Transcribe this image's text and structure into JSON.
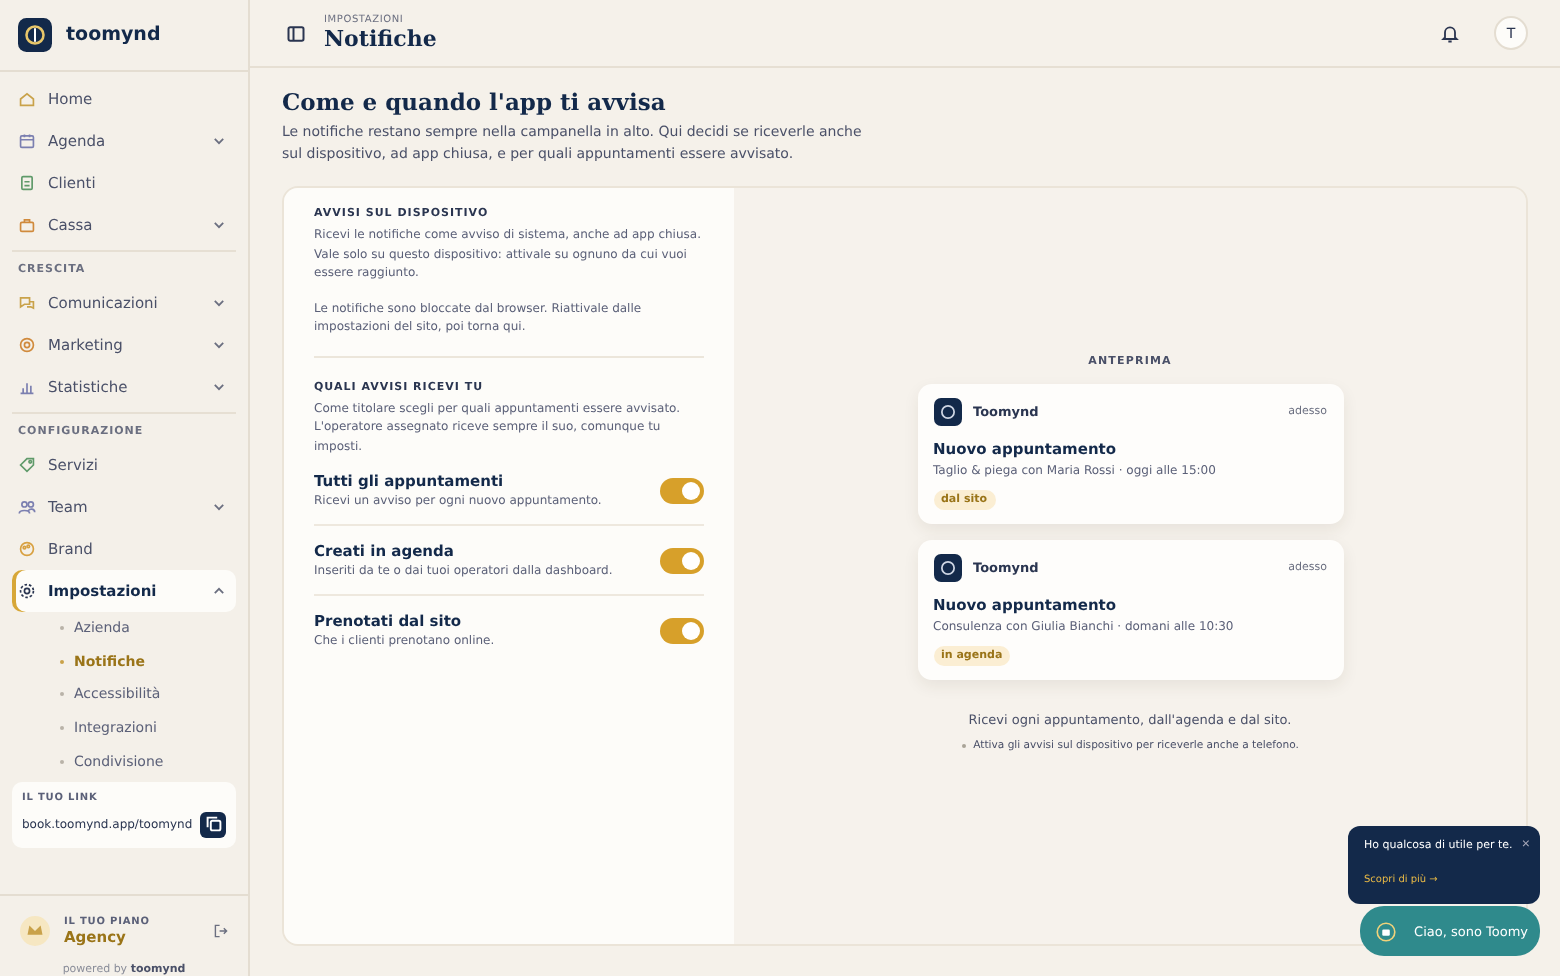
{
  "brand": {
    "name": "toomynd"
  },
  "sidebar": {
    "sections": [
      {
        "items": [
          {
            "label": "Home",
            "kind": "link",
            "selected": false
          },
          {
            "label": "Agenda",
            "kind": "menu",
            "expanded": false,
            "selected": false
          },
          {
            "label": "Clienti",
            "kind": "link",
            "selected": false
          },
          {
            "label": "Cassa",
            "kind": "menu",
            "expanded": false,
            "selected": false
          }
        ]
      },
      {
        "title": "CRESCITA",
        "items": [
          {
            "label": "Comunicazioni",
            "kind": "menu",
            "expanded": false,
            "selected": false
          },
          {
            "label": "Marketing",
            "kind": "menu",
            "expanded": false,
            "selected": false
          },
          {
            "label": "Statistiche",
            "kind": "menu",
            "expanded": false,
            "selected": false
          }
        ]
      },
      {
        "title": "CONFIGURAZIONE",
        "items": [
          {
            "label": "Servizi",
            "kind": "link",
            "selected": false
          },
          {
            "label": "Team",
            "kind": "menu",
            "expanded": false,
            "selected": false
          },
          {
            "label": "Brand",
            "kind": "link",
            "selected": false
          },
          {
            "label": "Impostazioni",
            "kind": "menu",
            "expanded": true,
            "selected": true,
            "children": [
              {
                "label": "Azienda",
                "selected": false
              },
              {
                "label": "Notifiche",
                "selected": true
              },
              {
                "label": "Accessibilità",
                "selected": false
              },
              {
                "label": "Integrazioni",
                "selected": false
              },
              {
                "label": "Condivisione",
                "selected": false
              }
            ]
          }
        ]
      }
    ],
    "link_card": {
      "title": "IL TUO LINK",
      "url": "book.toomynd.app/toomynd"
    },
    "plan": {
      "title": "IL TUO PIANO",
      "name": "Agency"
    },
    "powered": {
      "prefix": "powered by",
      "brand": "toomynd"
    }
  },
  "header": {
    "breadcrumb": "IMPOSTAZIONI",
    "title": "Notifiche",
    "avatar": "T"
  },
  "page": {
    "title": "Come e quando l'app ti avvisa",
    "intro": "Le notifiche restano sempre nella campanella in alto. Qui decidi se riceverle anche sul dispositivo, ad app chiusa, e per quali appuntamenti essere avvisato."
  },
  "device": {
    "title": "AVVISI SUL DISPOSITIVO",
    "text": "Ricevi le notifiche come avviso di sistema, anche ad app chiusa. Vale solo su questo dispositivo: attivale su ognuno da cui vuoi essere raggiunto.",
    "blocked": "Le notifiche sono bloccate dal browser. Riattivale dalle impostazioni del sito, poi torna qui."
  },
  "which": {
    "title": "QUALI AVVISI RICEVI TU",
    "text": "Come titolare scegli per quali appuntamenti essere avvisato. L'operatore assegnato riceve sempre il suo, comunque tu imposti.",
    "toggles": [
      {
        "label": "Tutti gli appuntamenti",
        "hint": "Ricevi un avviso per ogni nuovo appuntamento.",
        "on": true
      },
      {
        "label": "Creati in agenda",
        "hint": "Inseriti da te o dai tuoi operatori dalla dashboard.",
        "on": true
      },
      {
        "label": "Prenotati dal sito",
        "hint": "Che i clienti prenotano online.",
        "on": true
      }
    ]
  },
  "preview": {
    "title": "ANTEPRIMA",
    "notifications": [
      {
        "app": "Toomynd",
        "time": "adesso",
        "title": "Nuovo appuntamento",
        "text": "Taglio & piega con Maria Rossi · oggi alle 15:00",
        "tag": "dal sito"
      },
      {
        "app": "Toomynd",
        "time": "adesso",
        "title": "Nuovo appuntamento",
        "text": "Consulenza con Giulia Bianchi · domani alle 10:30",
        "tag": "in agenda"
      }
    ],
    "summary": "Ricevi ogni appuntamento, dall'agenda e dal sito.",
    "note": "Attiva gli avvisi sul dispositivo per riceverle anche a telefono."
  },
  "assistant": {
    "bubble": "Ho qualcosa di utile per te.",
    "close": "×",
    "link": "Scopri di più →",
    "button": "Ciao, sono Toomy"
  }
}
